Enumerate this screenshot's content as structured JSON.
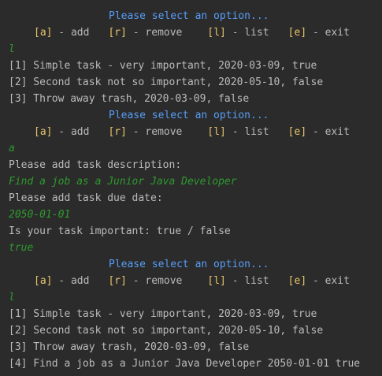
{
  "colors": {
    "background": "#2b2b2b",
    "prompt": "#589df6",
    "key": "#e8c46a",
    "text": "#bbbbbb",
    "user_input": "#2f9a2f"
  },
  "prompt": "Please select an option...",
  "menu": {
    "add": {
      "key": "[a]",
      "label": " - add"
    },
    "remove": {
      "key": "[r]",
      "label": " - remove"
    },
    "list": {
      "key": "[l]",
      "label": " - list"
    },
    "exit": {
      "key": "[e]",
      "label": " - exit"
    }
  },
  "session": {
    "input1": "l",
    "list1": [
      "[1] Simple task - very important, 2020-03-09, true",
      "[2] Second task not so important, 2020-05-10, false",
      "[3] Throw away trash, 2020-03-09, false"
    ],
    "input2": "a",
    "ask_description": "Please add task description:",
    "description_input": "Find a job as a Junior Java Developer",
    "ask_date": "Please add task due date:",
    "date_input": "2050-01-01",
    "ask_important": "Is your task important: true / false",
    "important_input": "true",
    "input3": "l",
    "list2": [
      "[1] Simple task - very important, 2020-03-09, true",
      "[2] Second task not so important, 2020-05-10, false",
      "[3] Throw away trash, 2020-03-09, false",
      "[4] Find a job as a Junior Java Developer 2050-01-01 true"
    ]
  }
}
